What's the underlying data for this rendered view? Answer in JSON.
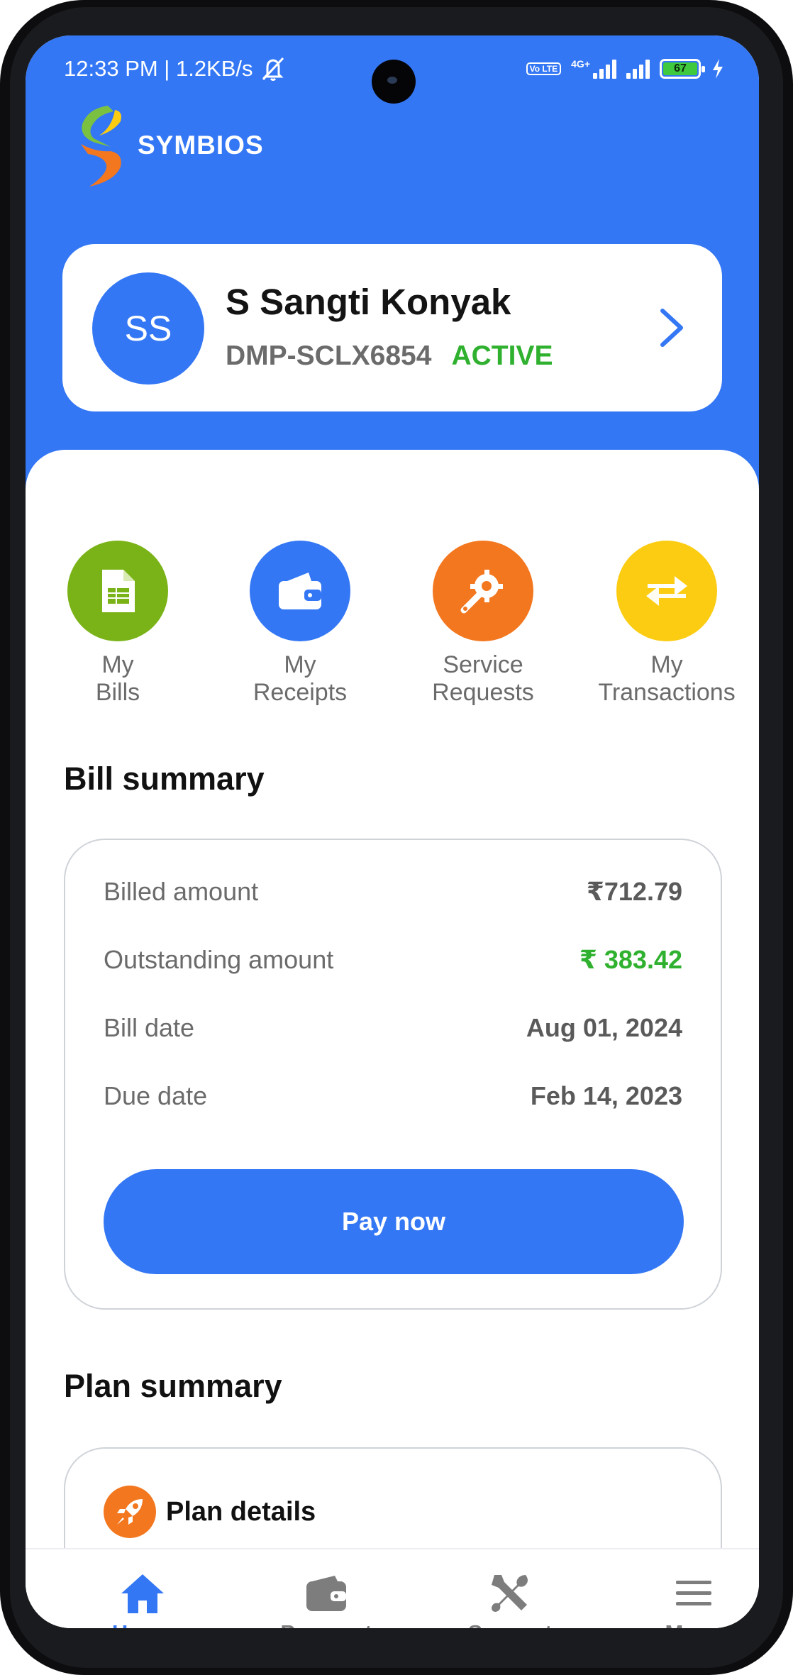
{
  "status_bar": {
    "time_speed": "12:33 PM | 1.2KB/s",
    "network_badge": "Vo LTE",
    "network_type": "4G+",
    "battery": "67"
  },
  "brand": {
    "name": "SYMBIOS"
  },
  "account": {
    "initials": "SS",
    "name": "S Sangti Konyak",
    "id": "DMP-SCLX6854",
    "status": "ACTIVE"
  },
  "quick_actions": [
    {
      "line1": "My",
      "line2": "Bills",
      "icon": "bill-document-icon",
      "color": "#7ab317"
    },
    {
      "line1": "My",
      "line2": "Receipts",
      "icon": "wallet-icon",
      "color": "#3477f5"
    },
    {
      "line1": "Service",
      "line2": "Requests",
      "icon": "gear-wrench-icon",
      "color": "#f3771f"
    },
    {
      "line1": "My",
      "line2": "Transactions",
      "icon": "swap-arrows-icon",
      "color": "#fbcc12"
    }
  ],
  "bill_summary": {
    "title": "Bill summary",
    "rows": [
      {
        "label": "Billed amount",
        "value": "₹712.79"
      },
      {
        "label": "Outstanding amount",
        "value": "₹ 383.42"
      },
      {
        "label": "Bill date",
        "value": "Aug 01, 2024"
      },
      {
        "label": "Due date",
        "value": "Feb 14, 2023"
      }
    ],
    "pay_button": "Pay now"
  },
  "plan_summary": {
    "title": "Plan summary",
    "card_title": "Plan details"
  },
  "bottom_nav": [
    {
      "label": "Home",
      "icon": "home-icon",
      "active": true
    },
    {
      "label": "Payment",
      "icon": "wallet-icon",
      "active": false
    },
    {
      "label": "Support",
      "icon": "tools-icon",
      "active": false
    },
    {
      "label": "Menu",
      "icon": "hamburger-menu-icon",
      "active": false
    }
  ],
  "colors": {
    "primary": "#3477f5",
    "active_green": "#2fb12f",
    "text_gray": "#6b6b6b"
  }
}
